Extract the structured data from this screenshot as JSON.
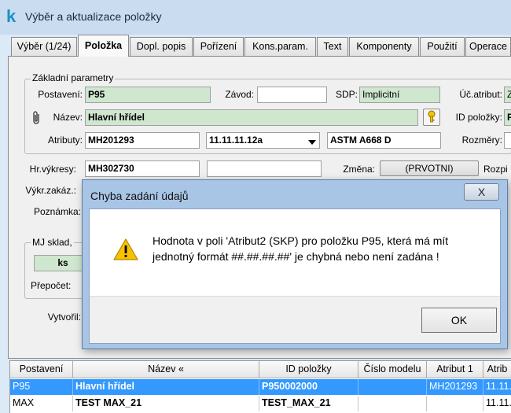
{
  "window": {
    "title": "Výběr a aktualizace položky",
    "app_icon": "k"
  },
  "tabs": [
    "Výběr (1/24)",
    "Položka",
    "Dopl. popis",
    "Pořízení",
    "Kons.param.",
    "Text",
    "Komponenty",
    "Použití",
    "Operace"
  ],
  "active_tab": "Položka",
  "basic": {
    "group_title": "Základní parametry",
    "postaveni_label": "Postavení:",
    "postaveni_value": "P95",
    "zavod_label": "Závod:",
    "zavod_value": "",
    "sdp_label": "SDP:",
    "sdp_value": "Implicitní",
    "uc_atribut_label": "Úč.atribut:",
    "uc_atribut_value": "Z",
    "nazev_label": "Název:",
    "nazev_value": "Hlavní hřídel",
    "id_polozky_label": "ID položky:",
    "id_polozky_value": "P",
    "atributy_label": "Atributy:",
    "atribut1_value": "MH201293",
    "atribut2_value": "11.11.11.12a",
    "atribut3_value": "ASTM A668 D",
    "rozmery_label": "Rozměry:"
  },
  "hr_vykresy_label": "Hr.výkresy:",
  "hr_vykresy_value": "MH302730",
  "hr_vykresy_value2": "",
  "zmena_label": "Změna:",
  "zmena_button": "(PRVOTNI)",
  "rozpis_label": "Rozpi",
  "vykr_zakaz_label": "Výkr.zakáz.:",
  "poznamka_label": "Poznámka:",
  "mj_group_title": "MJ sklad,",
  "mj_value": "ks",
  "prepocet_label": "Přepočet:",
  "vytvoril_label": "Vytvořil:",
  "dialog": {
    "title": "Chyba zadání údajů",
    "close_label": "X",
    "message_line1": "Hodnota v poli 'Atribut2 (SKP) pro položku P95, která má mít",
    "message_line2": "jednotný formát ##.##.##.##' je chybná nebo není zadána !",
    "icon": "warning-icon",
    "ok_label": "OK"
  },
  "table": {
    "columns": [
      "Postavení",
      "Název «",
      "ID položky",
      "Číslo modelu",
      "Atribut 1",
      "Atrib"
    ],
    "rows": [
      [
        "P95",
        "Hlavní hřídel",
        "P950002000",
        "",
        "MH201293",
        "11.11."
      ],
      [
        "MAX",
        "TEST MAX_21",
        "TEST_MAX_21",
        "",
        "",
        "11.11."
      ]
    ]
  },
  "colors": {
    "selected_row": "#3399ff",
    "green_field": "#cfe6cf",
    "title_bar": "#c9dcf0"
  }
}
